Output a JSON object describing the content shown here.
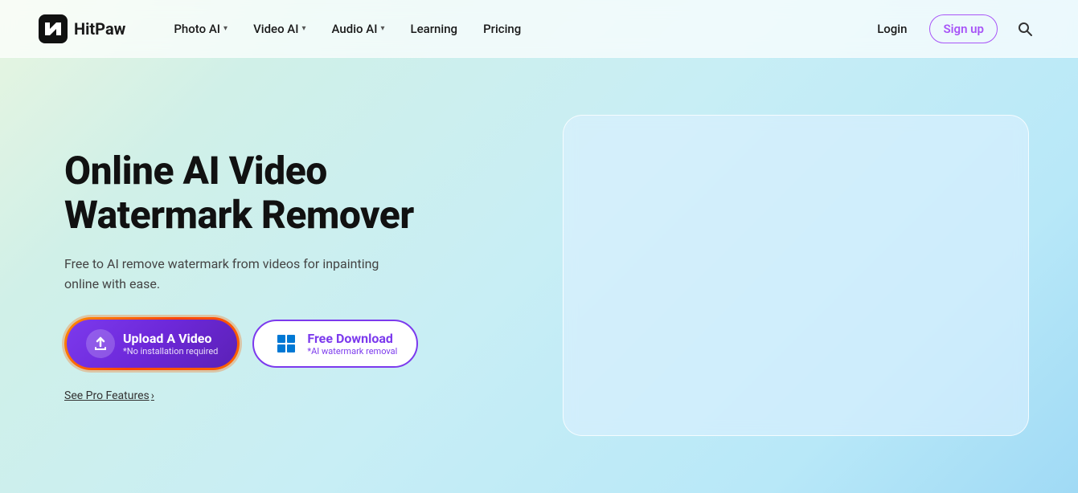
{
  "logo": {
    "text": "HitPaw"
  },
  "navbar": {
    "items": [
      {
        "label": "Photo AI",
        "hasDropdown": true
      },
      {
        "label": "Video AI",
        "hasDropdown": true
      },
      {
        "label": "Audio AI",
        "hasDropdown": true
      },
      {
        "label": "Learning",
        "hasDropdown": false
      },
      {
        "label": "Pricing",
        "hasDropdown": false
      }
    ],
    "login_label": "Login",
    "signup_label": "Sign up",
    "search_aria": "Search"
  },
  "hero": {
    "title_line1": "Online AI Video",
    "title_line2": "Watermark Remover",
    "subtitle": "Free to AI remove watermark from videos for inpainting online with ease.",
    "upload_btn": {
      "label": "Upload A Video",
      "sublabel": "*No installation required"
    },
    "download_btn": {
      "label": "Free Download",
      "sublabel": "*AI watermark removal"
    },
    "see_pro": "See Pro Features"
  }
}
